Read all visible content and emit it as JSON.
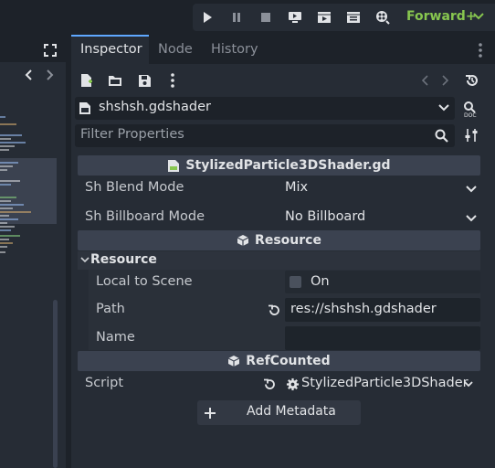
{
  "toolbar": {
    "renderer": "Forward+"
  },
  "dock": {
    "tabs": [
      "Inspector",
      "Node",
      "History"
    ],
    "resource_path_selector": "shshsh.gdshader",
    "filter_placeholder": "Filter Properties"
  },
  "inspector": {
    "class_header": "StylizedParticle3DShader.gd",
    "shader_params": [
      {
        "label": "Sh Blend Mode",
        "value": "Mix"
      },
      {
        "label": "Sh Billboard Mode",
        "value": "No Billboard"
      }
    ],
    "resource_header": "Resource",
    "resource_group": "Resource",
    "local_to_scene": {
      "label": "Local to Scene",
      "value": "On",
      "checked": false
    },
    "path": {
      "label": "Path",
      "value": "res://shshsh.gdshader"
    },
    "name": {
      "label": "Name",
      "value": ""
    },
    "refcounted_header": "RefCounted",
    "script": {
      "label": "Script",
      "value": "StylizedParticle3DShader"
    },
    "add_metadata": "Add Metadata"
  },
  "colors": {
    "accent": "#5fa8ff",
    "renderer_green": "#87c64f",
    "panel_bg": "#262c35",
    "base_bg": "#1d2229",
    "header_bg": "#3b4250"
  }
}
